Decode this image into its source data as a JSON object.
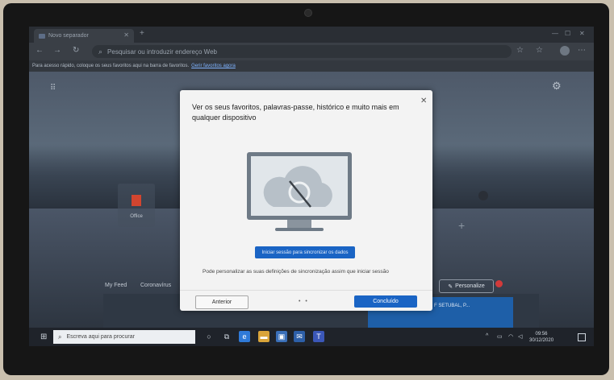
{
  "browser": {
    "tab_title": "Novo separador",
    "address_placeholder": "Pesquisar ou introduzir endereço Web",
    "favorites_bar_text": "Para acesso rápido, coloque os seus favoritos aqui na barra de favoritos.",
    "favorites_bar_link": "Gerir favoritos agora"
  },
  "newtab": {
    "tile_label": "Office",
    "feed_tabs": [
      "My Feed",
      "Coronavírus"
    ],
    "personalize_label": "Personalize",
    "news_text": "F SETUBAL, P..."
  },
  "dialog": {
    "title": "Ver os seus favoritos, palavras-passe, histórico e muito mais em qualquer dispositivo",
    "primary_button": "Iniciar sessão para sincronizar os dados",
    "info_text": "Pode personalizar as suas definições de sincronização assim que iniciar sessão",
    "back_button": "Anterior",
    "done_button": "Concluído",
    "pager": "• •"
  },
  "taskbar": {
    "search_placeholder": "Escreva aqui para procurar",
    "time": "09:56",
    "date": "30/12/2020"
  },
  "icons": [
    "search-icon",
    "close-icon",
    "settings-icon",
    "apps-grid-icon",
    "windows-start-icon",
    "cloud-sync-icon"
  ],
  "colors": {
    "accent": "#1a64c4",
    "taskbar": "#1f232a",
    "dialog": "#f3f3f3"
  }
}
